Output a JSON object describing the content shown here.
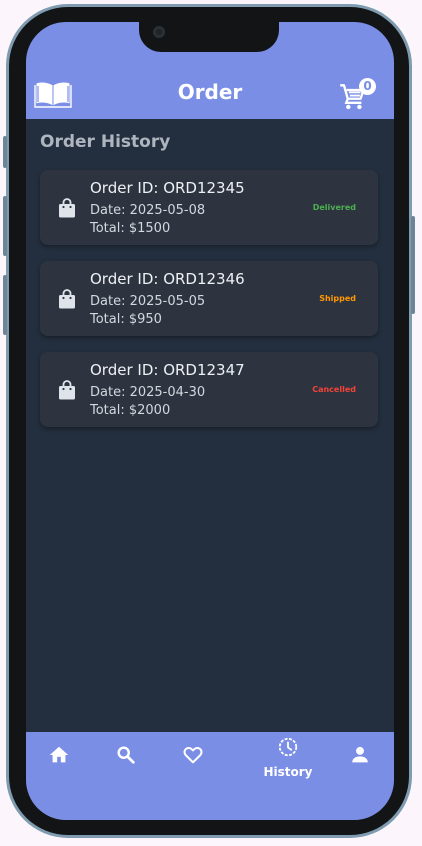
{
  "app": {
    "title": "Order",
    "cart_count": "0"
  },
  "section": {
    "title": "Order History"
  },
  "orders": [
    {
      "id": "Order ID: ORD12345",
      "date": "Date: 2025-05-08",
      "total": "Total: $1500",
      "status": "Delivered",
      "status_color": "#4caf50"
    },
    {
      "id": "Order ID: ORD12346",
      "date": "Date: 2025-05-05",
      "total": "Total: $950",
      "status": "Shipped",
      "status_color": "#ff9800"
    },
    {
      "id": "Order ID: ORD12347",
      "date": "Date: 2025-04-30",
      "total": "Total: $2000",
      "status": "Cancelled",
      "status_color": "#f44336"
    }
  ],
  "nav": {
    "items": [
      {
        "icon": "home-icon"
      },
      {
        "icon": "search-icon"
      },
      {
        "icon": "heart-icon"
      },
      {
        "icon": "history-icon",
        "label": "History",
        "active": true
      },
      {
        "icon": "person-icon"
      }
    ]
  },
  "colors": {
    "accent": "#7b8ee6",
    "background": "#232f3e",
    "card": "#2d3440"
  }
}
